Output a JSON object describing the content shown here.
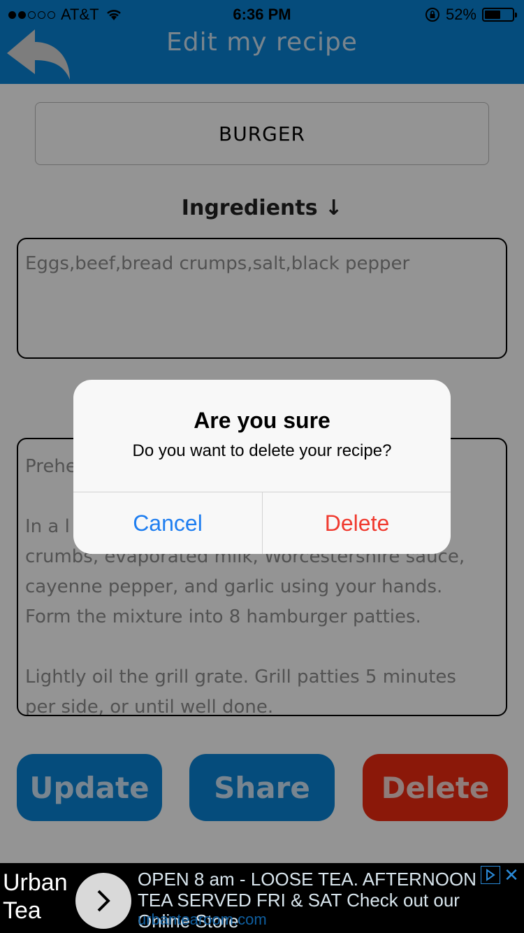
{
  "status_bar": {
    "carrier": "AT&T",
    "time": "6:36 PM",
    "battery": "52%",
    "battery_level": 0.52,
    "signal_filled": 2,
    "signal_total": 5
  },
  "nav": {
    "title": "Edit my recipe",
    "back_icon": "back-arrow-icon"
  },
  "recipe": {
    "name": "BURGER",
    "ingredients_label": "Ingredients ↓",
    "ingredients": "Eggs,beef,bread crumps,salt,black pepper",
    "directions": "Prehe\n\nIn a l                                                   read\ncrumbs, evaporated milk, Worcestershire sauce,\ncayenne pepper, and garlic using your hands.\nForm the mixture into 8 hamburger patties.\n\nLightly oil the grill grate. Grill patties 5 minutes\nper side, or until well done."
  },
  "actions": {
    "update": "Update",
    "share": "Share",
    "delete": "Delete"
  },
  "alert": {
    "title": "Are you sure",
    "message": "Do you want to delete your recipe?",
    "cancel": "Cancel",
    "confirm": "Delete"
  },
  "ad": {
    "brand_line1": "Urban",
    "brand_line2": "Tea",
    "text": "OPEN 8 am - LOOSE TEA. AFTERNOON TEA SERVED FRI & SAT Check out our Online Store",
    "url": "urbantearoom.com"
  },
  "colors": {
    "primary": "#0a84d6",
    "danger": "#f02a10",
    "alert_cancel": "#1f7ef0",
    "alert_delete": "#f03a2f"
  }
}
